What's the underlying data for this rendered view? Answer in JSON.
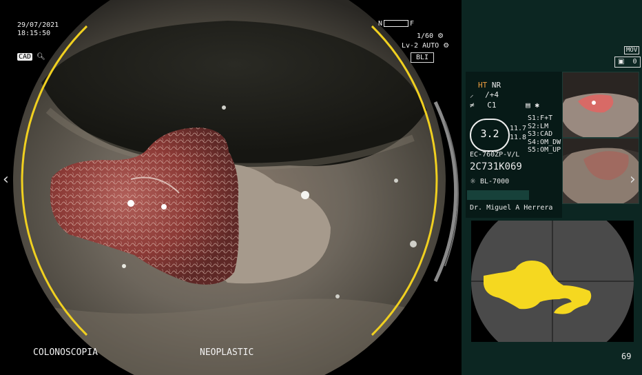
{
  "overlay": {
    "date": "29/07/2021",
    "time": "18:15:50",
    "cad_label": "CAD",
    "shutter": "1/60",
    "level": "Lv-2",
    "mode_auto": "AUTO",
    "mode_label": "BLI",
    "zoom_n": "N",
    "zoom_f": "F",
    "bottom_left": "COLONOSCOPIA",
    "bottom_center": "NEOPLASTIC"
  },
  "panel": {
    "mov_label": "MOV",
    "photo_count": "0",
    "ht": "HT",
    "nr": "NR",
    "enhance": "/+4",
    "color": "C1",
    "meter_value": "3.2",
    "val_a": "11.7",
    "val_b": "11.8",
    "s1": "S1:F+T",
    "s2": "S2:LM",
    "s3": "S3:CAD",
    "s4": "S4:OM_DW",
    "s5": "S5:OM_UP",
    "scope_model": "EC-760ZP-V/L",
    "serial": "2C731K069",
    "light_source": "BL-7000",
    "doctor": "Dr. Miguel A Herrera",
    "frame_number": "69"
  },
  "icons": [
    "search-icon",
    "camera-icon",
    "sun-icon",
    "gear-icon",
    "chevron-left-icon",
    "chevron-right-icon"
  ],
  "colors": {
    "ring": "#f0d020",
    "cad_mask": "#f5d820",
    "panel_bg": "#0c2622"
  }
}
